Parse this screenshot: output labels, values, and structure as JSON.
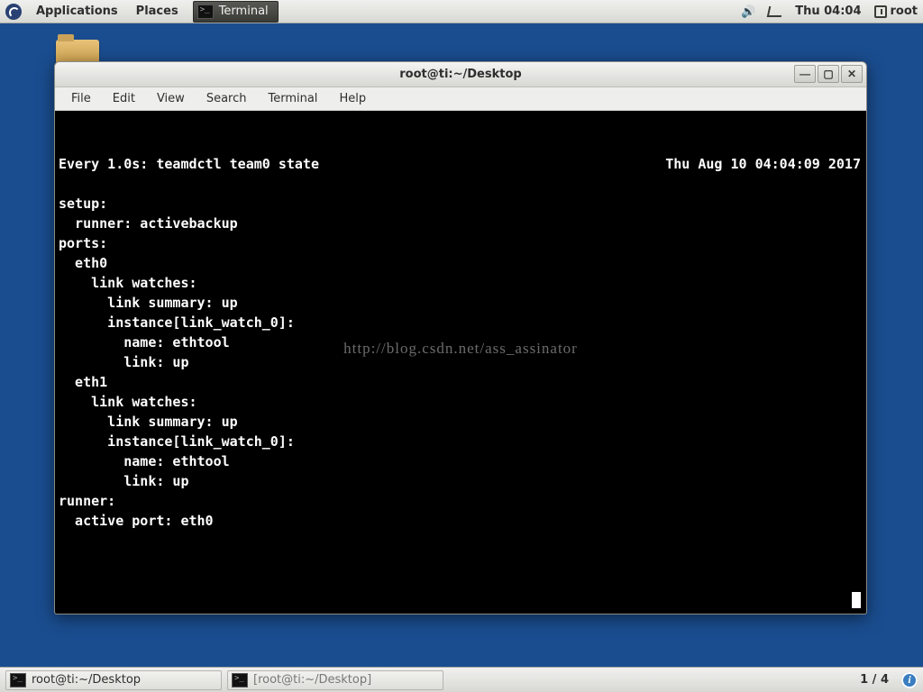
{
  "topbar": {
    "applications": "Applications",
    "places": "Places",
    "task_terminal": "Terminal",
    "clock": "Thu 04:04",
    "user": "root"
  },
  "window": {
    "title": "root@ti:~/Desktop",
    "menu": {
      "file": "File",
      "edit": "Edit",
      "view": "View",
      "search": "Search",
      "terminal": "Terminal",
      "help": "Help"
    },
    "controls": {
      "min": "—",
      "max": "▢",
      "close": "✕"
    }
  },
  "terminal": {
    "watch_header_left": "Every 1.0s: teamdctl team0 state",
    "watch_header_right": "Thu Aug 10 04:04:09 2017",
    "lines": [
      "",
      "setup:",
      "  runner: activebackup",
      "ports:",
      "  eth0",
      "    link watches:",
      "      link summary: up",
      "      instance[link_watch_0]:",
      "        name: ethtool",
      "        link: up",
      "  eth1",
      "    link watches:",
      "      link summary: up",
      "      instance[link_watch_0]:",
      "        name: ethtool",
      "        link: up",
      "runner:",
      "  active port: eth0"
    ]
  },
  "watermark": "http://blog.csdn.net/ass_assinator",
  "bottombar": {
    "task1": "root@ti:~/Desktop",
    "task2": "[root@ti:~/Desktop]",
    "workspace": "1 / 4"
  }
}
